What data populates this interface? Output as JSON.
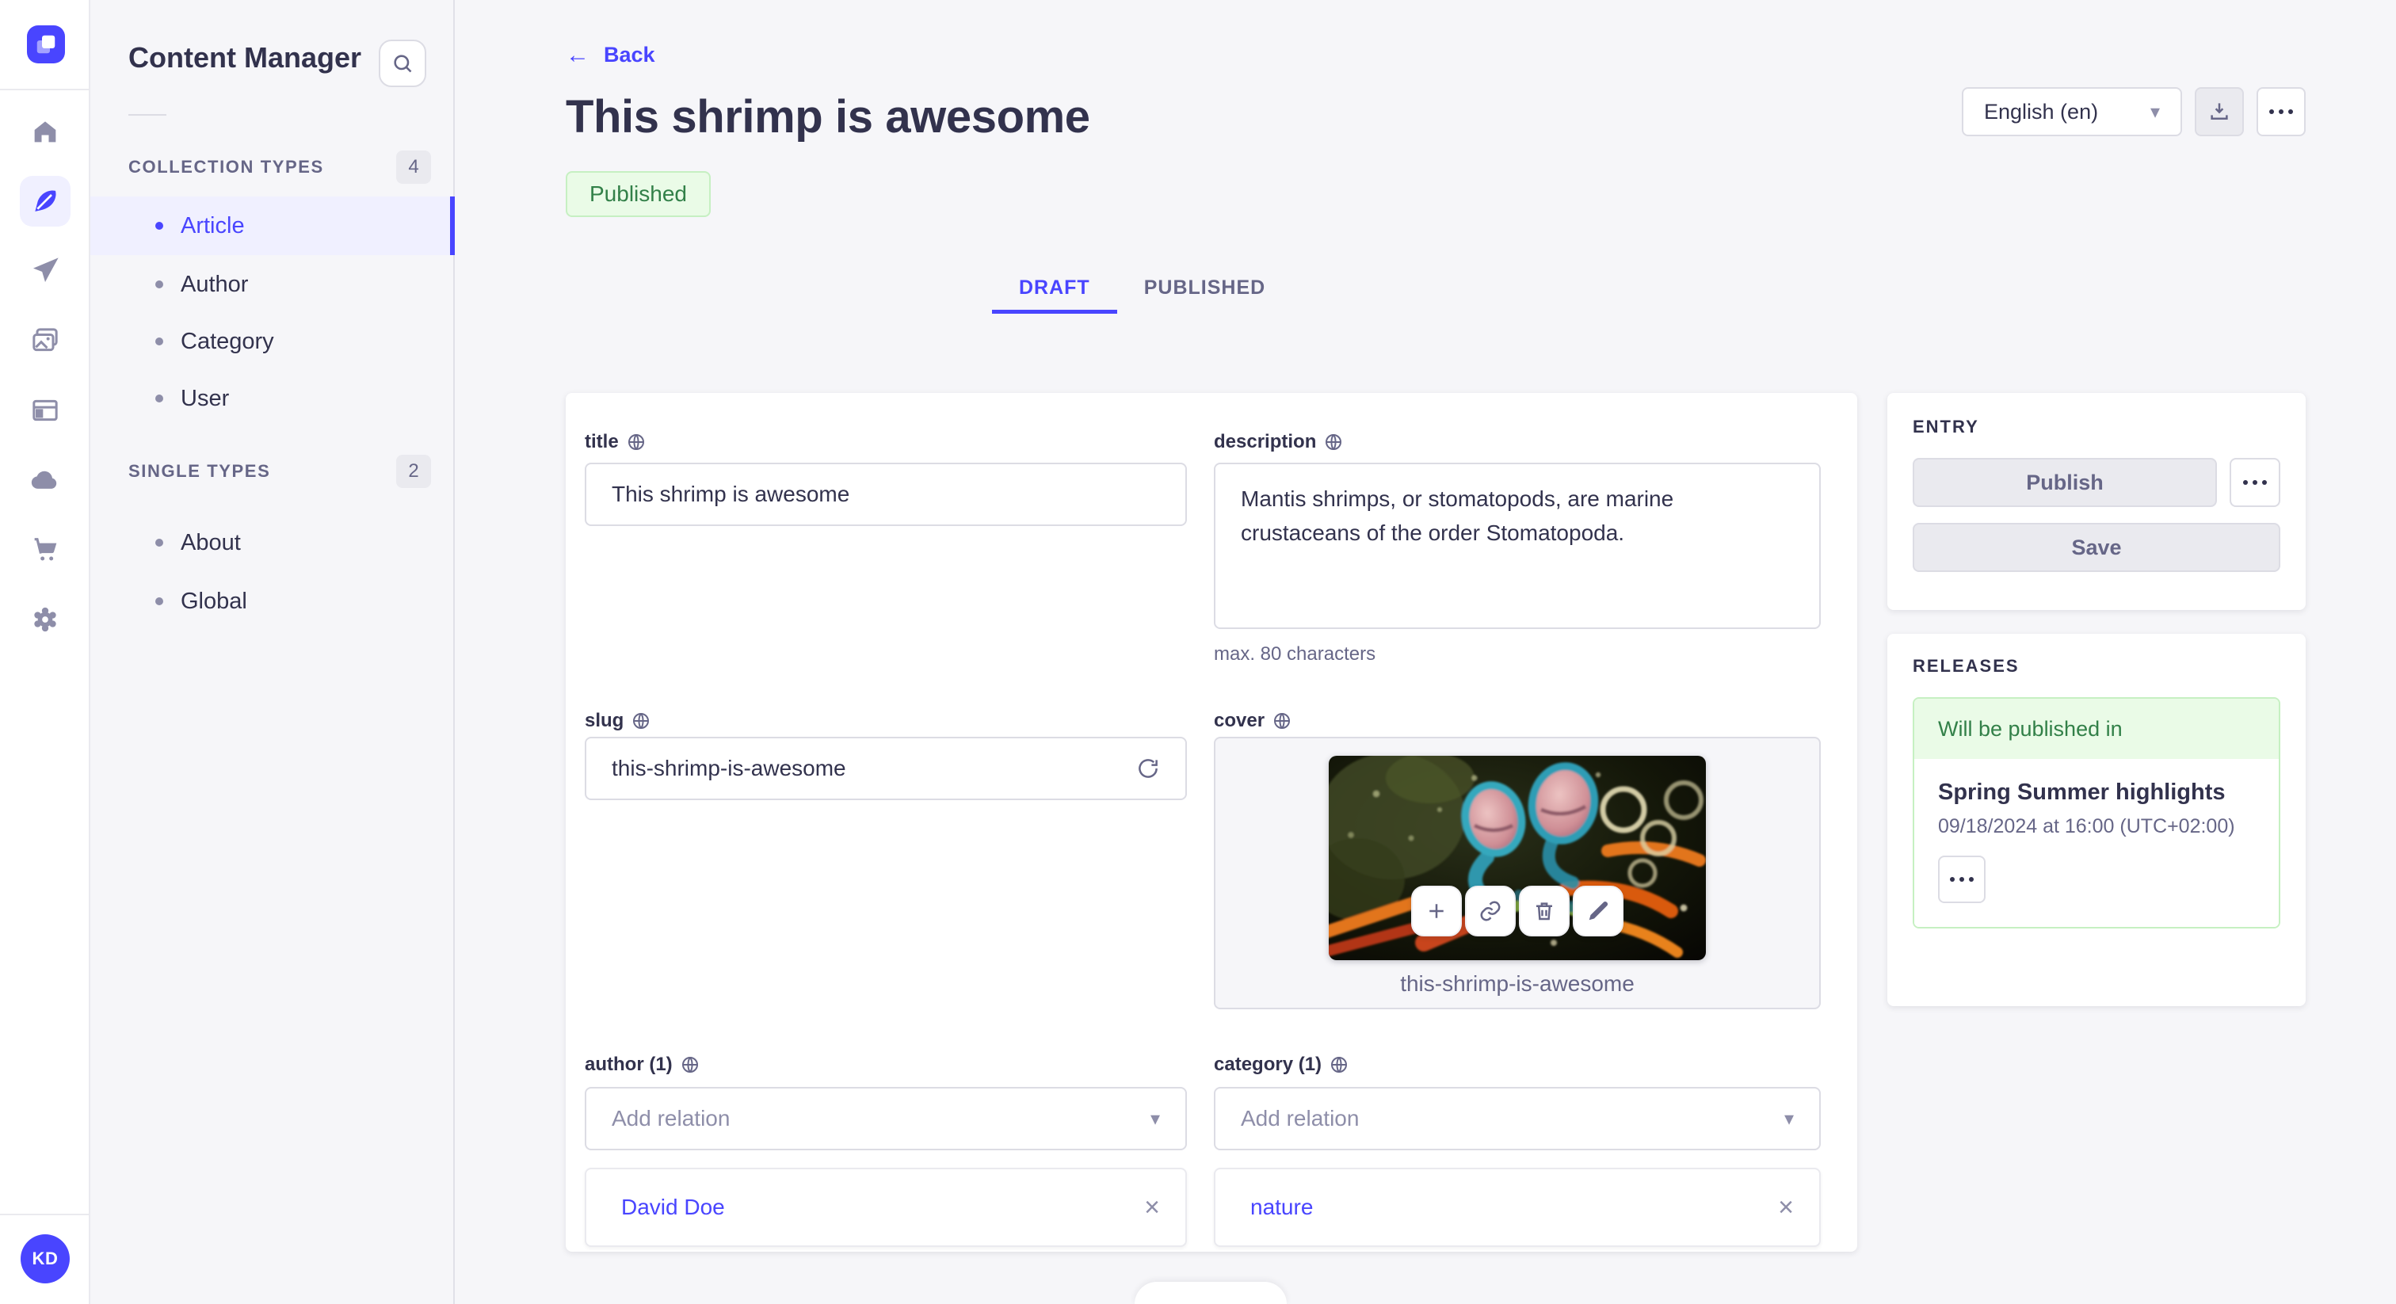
{
  "brand": {
    "logo_label": "Strapi",
    "avatar_initials": "KD"
  },
  "colors": {
    "accent": "#4945ff",
    "accent_bg": "#f0f0ff",
    "success_text": "#328048",
    "success_bg": "#eafbe7",
    "success_border": "#c6f0c2",
    "page_bg": "#f6f6f9",
    "text": "#32324d",
    "text_muted": "#666687",
    "border": "#dcdce4"
  },
  "nav": {
    "icons": [
      "home",
      "content-manager",
      "releases",
      "media-library",
      "marketplace",
      "cloud",
      "purchases",
      "settings"
    ]
  },
  "subnav": {
    "title": "Content Manager",
    "sections": [
      {
        "label": "COLLECTION TYPES",
        "count": "4",
        "items": [
          {
            "label": "Article"
          },
          {
            "label": "Author"
          },
          {
            "label": "Category"
          },
          {
            "label": "User"
          }
        ]
      },
      {
        "label": "SINGLE TYPES",
        "count": "2",
        "items": [
          {
            "label": "About"
          },
          {
            "label": "Global"
          }
        ]
      }
    ]
  },
  "header": {
    "back_label": "Back",
    "back_arrow": "←",
    "title": "This shrimp is awesome",
    "status": "Published",
    "locale": "English (en)",
    "caret": "▾",
    "tabs": [
      {
        "label": "DRAFT"
      },
      {
        "label": "PUBLISHED"
      }
    ]
  },
  "form": {
    "title": {
      "label": "title",
      "value": "This shrimp is awesome"
    },
    "description": {
      "label": "description",
      "value": "Mantis shrimps, or stomatopods, are marine crustaceans of the order Stomatopoda.",
      "helper": "max. 80 characters"
    },
    "slug": {
      "label": "slug",
      "value": "this-shrimp-is-awesome"
    },
    "cover": {
      "label": "cover",
      "filename": "this-shrimp-is-awesome"
    },
    "author": {
      "label": "author (1)",
      "placeholder": "Add relation",
      "relation": "David Doe",
      "remove": "×"
    },
    "category": {
      "label": "category (1)",
      "placeholder": "Add relation",
      "relation": "nature",
      "remove": "×"
    }
  },
  "entry_panel": {
    "title": "ENTRY",
    "publish_label": "Publish",
    "save_label": "Save"
  },
  "releases_panel": {
    "title": "RELEASES",
    "status": "Will be published in",
    "release_name": "Spring Summer highlights",
    "release_date": "09/18/2024 at 16:00 (UTC+02:00)"
  }
}
